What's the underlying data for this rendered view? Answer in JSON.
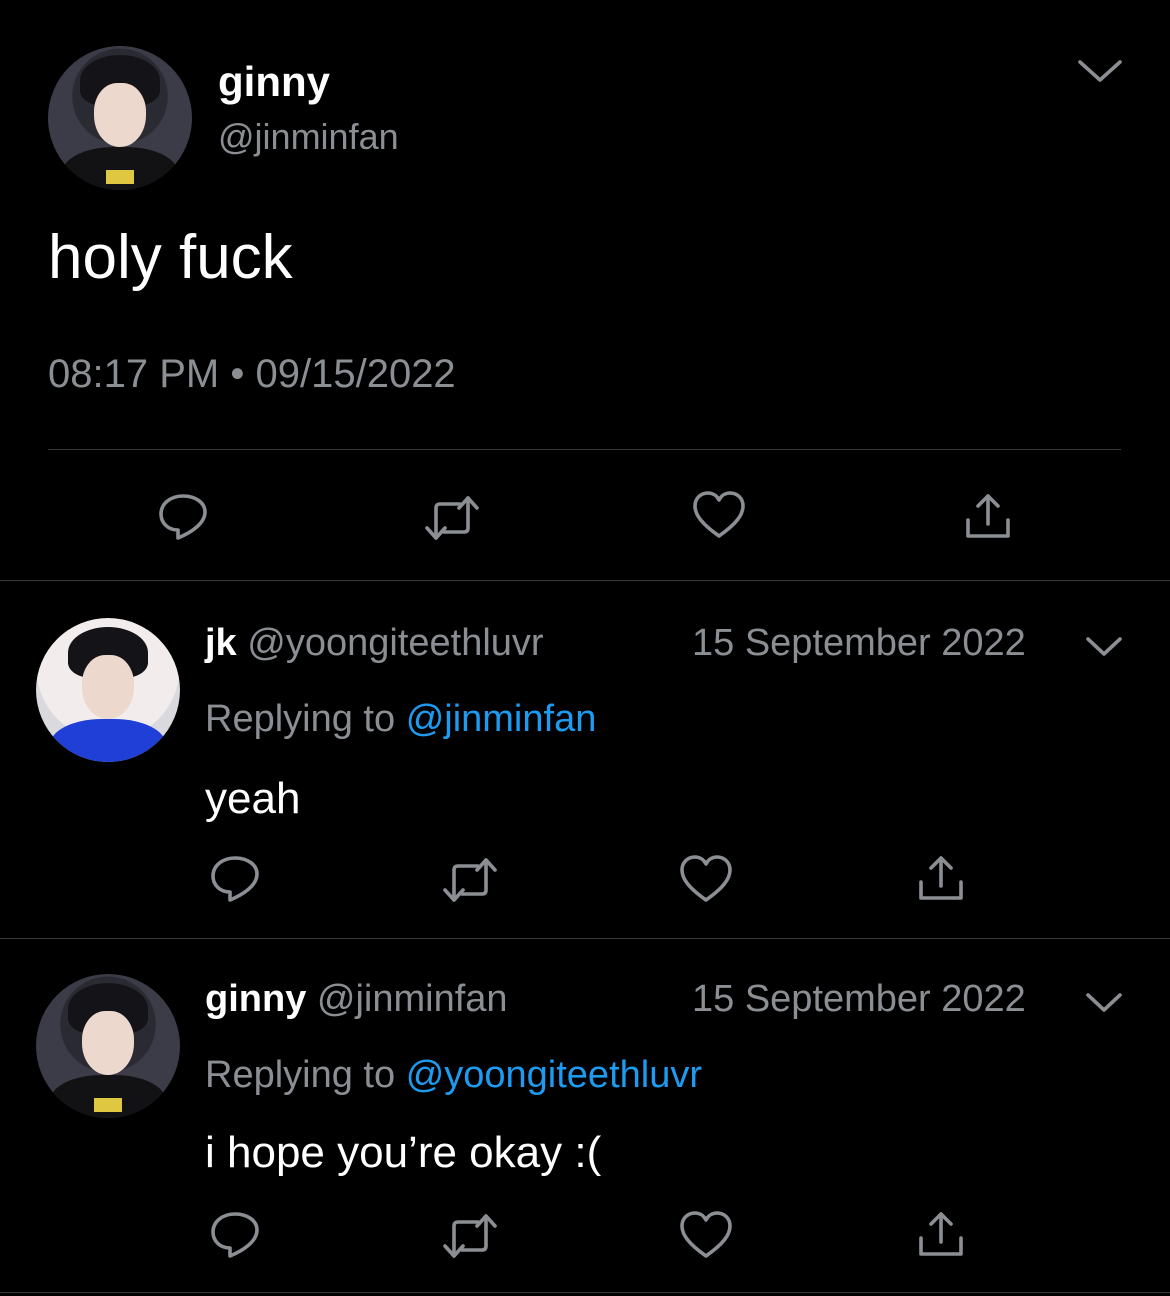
{
  "main_tweet": {
    "display_name": "ginny",
    "handle": "@jinminfan",
    "text": "holy fuck",
    "time": "08:17 PM",
    "separator": "•",
    "date": "09/15/2022"
  },
  "replies": [
    {
      "display_name": "jk",
      "handle": "@yoongiteethluvr",
      "date": "15 September 2022",
      "replying_prefix": "Replying to",
      "replying_to": "@jinminfan",
      "text": "yeah"
    },
    {
      "display_name": "ginny",
      "handle": "@jinminfan",
      "date": "15 September 2022",
      "replying_prefix": "Replying to",
      "replying_to": "@yoongiteethluvr",
      "text": "i hope you’re okay :("
    }
  ],
  "icons": [
    "chevron-down-icon",
    "reply-icon",
    "retweet-icon",
    "like-icon",
    "share-icon"
  ],
  "colors": {
    "background": "#000000",
    "text": "#ffffff",
    "secondary": "#8b8f94",
    "link": "#1d9bf0"
  }
}
